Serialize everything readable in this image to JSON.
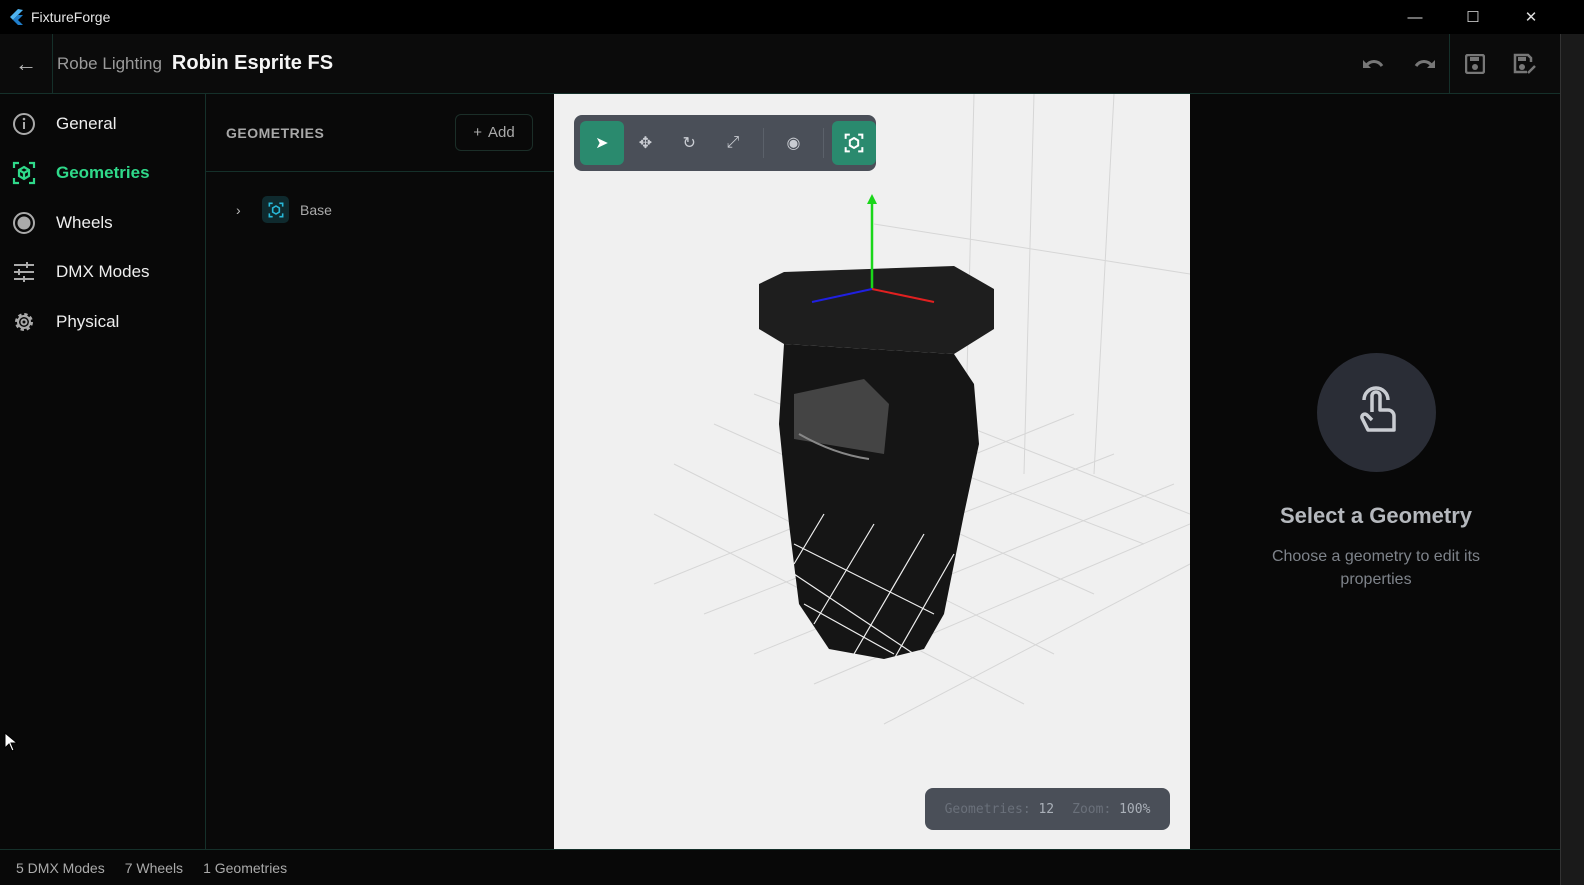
{
  "app": {
    "title": "FixtureForge"
  },
  "window": {
    "minimize": "—",
    "maximize": "☐",
    "close": "✕"
  },
  "header": {
    "manufacturer": "Robe Lighting",
    "fixture": "Robin Esprite FS"
  },
  "sidebar": {
    "items": [
      {
        "label": "General",
        "icon": "info-icon",
        "active": false
      },
      {
        "label": "Geometries",
        "icon": "cube-focus-icon",
        "active": true
      },
      {
        "label": "Wheels",
        "icon": "radio-icon",
        "active": false
      },
      {
        "label": "DMX Modes",
        "icon": "sliders-icon",
        "active": false
      },
      {
        "label": "Physical",
        "icon": "gear-icon",
        "active": false
      }
    ]
  },
  "geometries": {
    "heading": "GEOMETRIES",
    "add_label": "Add",
    "items": [
      {
        "name": "Base"
      }
    ]
  },
  "viewport": {
    "stats": {
      "geometries_label": "Geometries:",
      "geometries_value": "12",
      "zoom_label": "Zoom:",
      "zoom_value": "100%"
    }
  },
  "details": {
    "title": "Select a Geometry",
    "description": "Choose a geometry to edit its properties"
  },
  "status": {
    "dmx_modes": "5 DMX Modes",
    "wheels": "7 Wheels",
    "geometries": "1 Geometries"
  },
  "colors": {
    "accent": "#2fd98a",
    "toolbar_active": "#2a8a6e",
    "viewport_bg": "#f0f0f0"
  }
}
